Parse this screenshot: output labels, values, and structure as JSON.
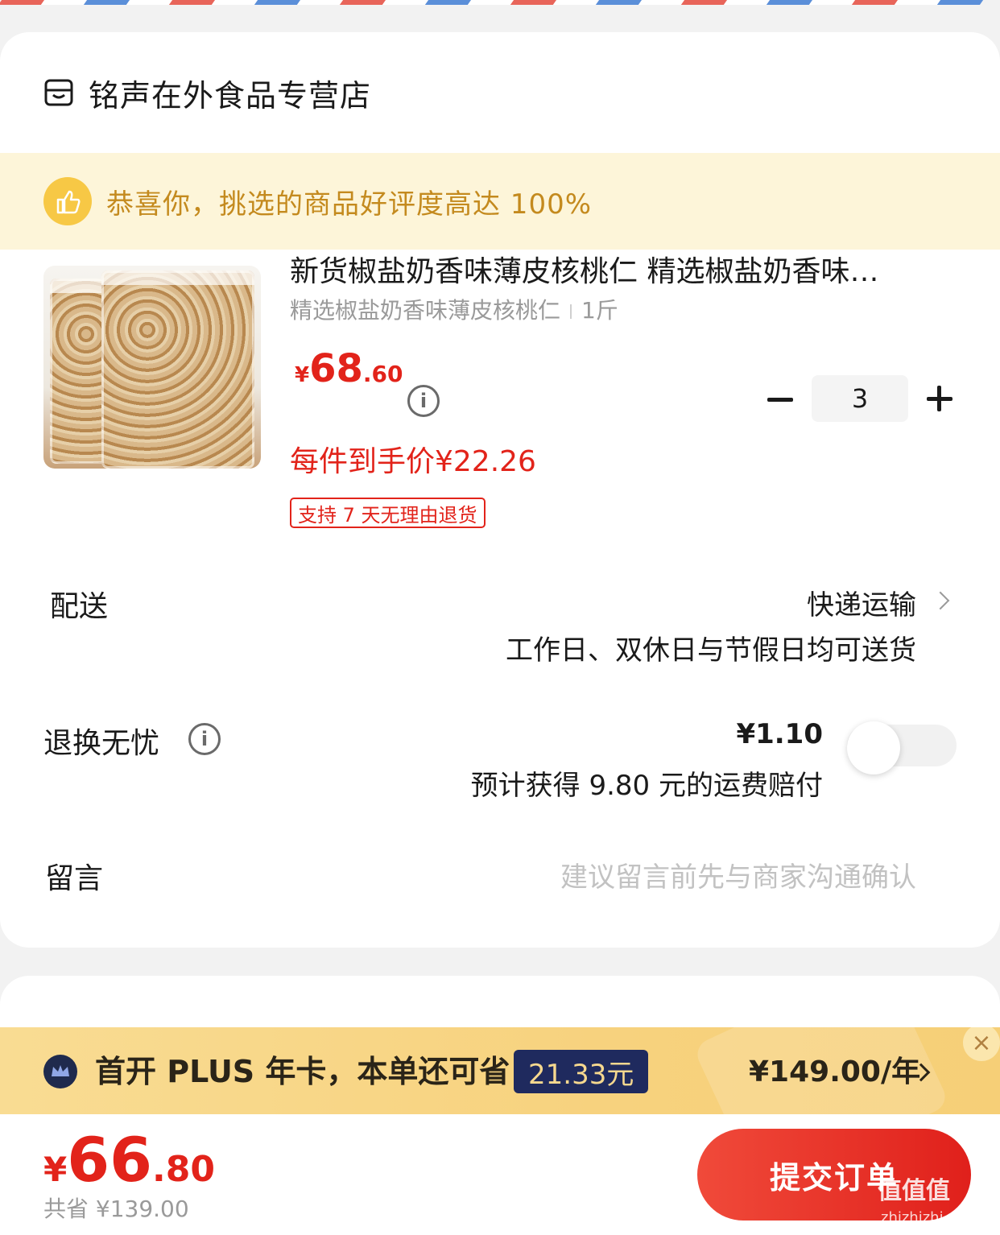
{
  "shop": {
    "name": "铭声在外食品专营店",
    "icon": "store-icon"
  },
  "praise": {
    "text": "恭喜你，挑选的商品好评度高达 100%",
    "icon": "thumbs-up-icon"
  },
  "product": {
    "title": "新货椒盐奶香味薄皮核桃仁 精选椒盐奶香味…",
    "spec_name": "精选椒盐奶香味薄皮核桃仁",
    "spec_weight": "1斤",
    "price_currency": "¥",
    "price_int": "68",
    "price_dec": ".60",
    "each_price": "每件到手价¥22.26",
    "return_tag": "支持 7 天无理由退货",
    "quantity": "3"
  },
  "delivery": {
    "label": "配送",
    "method": "快递运输",
    "note": "工作日、双休日与节假日均可送货"
  },
  "return_insurance": {
    "label": "退换无忧",
    "price": "¥1.10",
    "note": "预计获得 9.80 元的运费赔付",
    "enabled": false
  },
  "message": {
    "label": "留言",
    "placeholder": "建议留言前先与商家沟通确认"
  },
  "plus": {
    "text": "首开 PLUS 年卡，本单还可省",
    "save": "21.33元",
    "price": "¥149.00/年",
    "close": "×"
  },
  "footer": {
    "total_currency": "¥",
    "total_int": "66",
    "total_dec": ".80",
    "saved": "共省 ¥139.00",
    "submit": "提交订单",
    "watermark": "值值值",
    "watermark_sub": "zhizhizhi.com"
  },
  "colors": {
    "accent": "#e2231a",
    "praise_bg": "#fdf5d9",
    "plus_bg": "#f7d27e"
  }
}
